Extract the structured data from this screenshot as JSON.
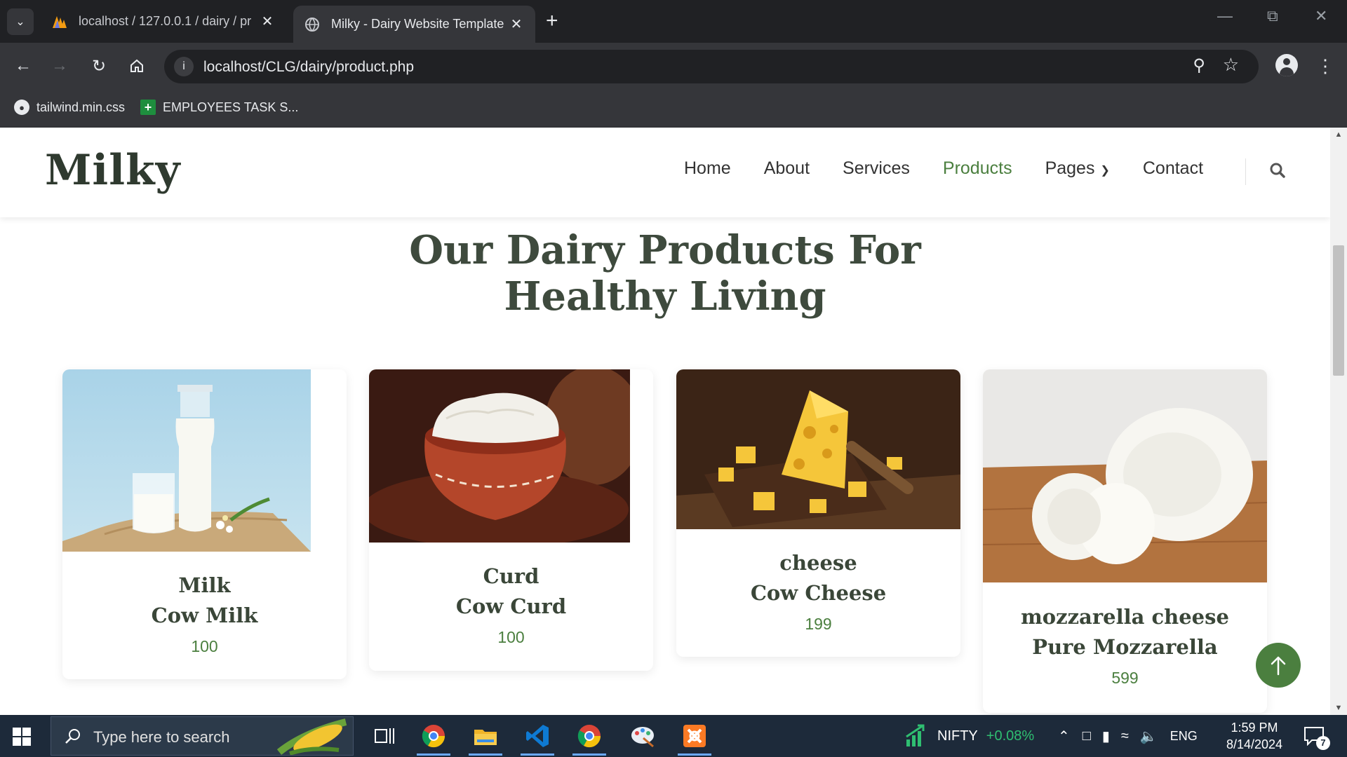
{
  "browser": {
    "tabs": [
      {
        "title": "localhost / 127.0.0.1 / dairy / pr",
        "active": false,
        "favicon": "phpmyadmin-icon"
      },
      {
        "title": "Milky - Dairy Website Template",
        "active": true,
        "favicon": "globe-icon"
      }
    ],
    "url": "localhost/CLG/dairy/product.php",
    "bookmarks": [
      {
        "label": "tailwind.min.css",
        "icon": "globe-icon"
      },
      {
        "label": "EMPLOYEES TASK S...",
        "icon": "sheets-icon"
      }
    ]
  },
  "site": {
    "logo": "Milky",
    "nav": [
      {
        "label": "Home",
        "active": false
      },
      {
        "label": "About",
        "active": false
      },
      {
        "label": "Services",
        "active": false
      },
      {
        "label": "Products",
        "active": true
      },
      {
        "label": "Pages",
        "active": false,
        "dropdown": true
      },
      {
        "label": "Contact",
        "active": false
      }
    ],
    "section_title_line1": "Our Dairy Products For",
    "section_title_line2": "Healthy Living",
    "products": [
      {
        "category": "Milk",
        "name": "Cow Milk",
        "price": "100"
      },
      {
        "category": "Curd",
        "name": "Cow Curd",
        "price": "100"
      },
      {
        "category": "cheese",
        "name": "Cow Cheese",
        "price": "199"
      },
      {
        "category": "mozzarella cheese",
        "name": "Pure Mozzarella",
        "price": "599"
      }
    ],
    "colors": {
      "accent": "#4b7f3f",
      "heading": "#3e4a3d"
    }
  },
  "taskbar": {
    "search_placeholder": "Type here to search",
    "apps": [
      "chrome-icon",
      "task-view-icon",
      "file-explorer-icon",
      "vscode-icon",
      "chrome-icon",
      "paint-icon",
      "xampp-icon"
    ],
    "ticker_label": "NIFTY",
    "ticker_change": "+0.08%",
    "language": "ENG",
    "time": "1:59 PM",
    "date": "8/14/2024",
    "notification_count": "7"
  }
}
